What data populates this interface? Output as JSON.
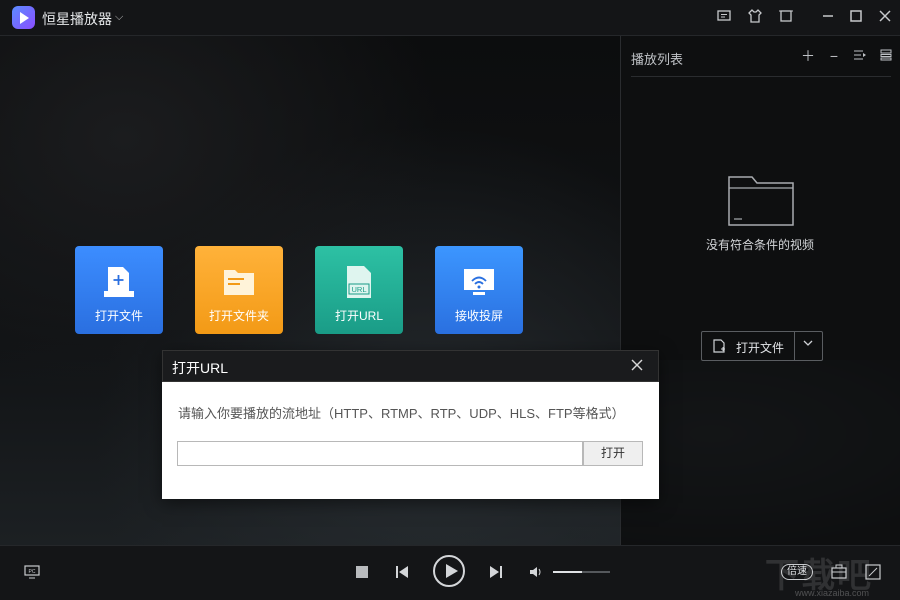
{
  "app": {
    "title": "恒星播放器"
  },
  "titlebar": {
    "icons": [
      "feedback-icon",
      "skin-icon",
      "mini-mode-icon",
      "minimize-icon",
      "maximize-icon",
      "close-icon"
    ]
  },
  "tiles": [
    {
      "label": "打开文件",
      "color": "#3c8dff"
    },
    {
      "label": "打开文件夹",
      "color": "#ffb23a"
    },
    {
      "label": "打开URL",
      "color": "#2dc1a4"
    },
    {
      "label": "接收投屏",
      "color": "#3c96ff"
    }
  ],
  "url_icon_text": "URL",
  "playlist": {
    "title": "播放列表",
    "empty_text": "没有符合条件的视频",
    "open_file_label": "打开文件"
  },
  "dialog": {
    "title": "打开URL",
    "prompt": "请输入你要播放的流地址（HTTP、RTMP、RTP、UDP、HLS、FTP等格式）",
    "input_value": "",
    "open_label": "打开"
  },
  "controls": {
    "speed_label": "倍速",
    "volume_fraction": 0.5
  },
  "watermark": {
    "text": "下载吧",
    "site": "www.xiazaiba.com"
  }
}
